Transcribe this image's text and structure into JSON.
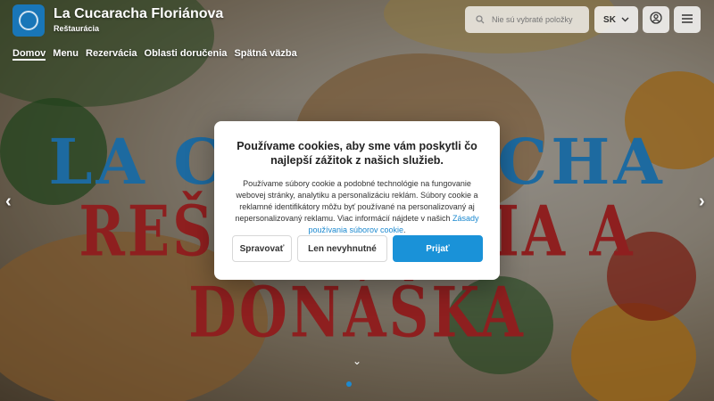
{
  "header": {
    "title": "La Cucaracha Floriánova",
    "subtitle": "Reštaurácia",
    "search_placeholder": "Nie sú vybraté položky",
    "language": "SK"
  },
  "nav": {
    "items": [
      "Domov",
      "Menu",
      "Rezervácia",
      "Oblasti doručenia",
      "Spätná väzba"
    ]
  },
  "hero": {
    "line1": "LA CUCARACHA",
    "line2": "REŠTAURÁCIA A DONÁŠKA"
  },
  "cookie": {
    "title": "Používame cookies, aby sme vám poskytli čo najlepší zážitok z našich služieb.",
    "body": "Používame súbory cookie a podobné technológie na fungovanie webovej stránky, analytiku a personalizáciu reklám. Súbory cookie a reklamné identifikátory môžu byť používané na personalizovaný aj nepersonalizovaný reklamu. Viac informácií nájdete v našich ",
    "link": "Zásady používania súborov cookie",
    "body_end": ".",
    "manage_label": "Spravovať",
    "necessary_label": "Len nevyhnutné",
    "accept_label": "Prijať"
  },
  "colors": {
    "accent": "#1a92d8",
    "brand": "#1976b8",
    "hero_red": "#8e1f1f"
  },
  "icons": {
    "search": "search-icon",
    "chevron": "chevron-down-icon",
    "account": "user-icon",
    "menu": "hamburger-icon"
  }
}
